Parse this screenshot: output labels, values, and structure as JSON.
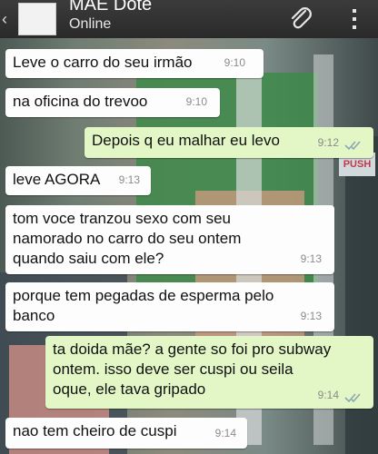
{
  "header": {
    "back_glyph": "‹",
    "contact_name": "MÃE Dote",
    "status": "Online",
    "icons": [
      "back-icon",
      "avatar",
      "paperclip-icon",
      "overflow-menu-icon"
    ]
  },
  "messages": [
    {
      "direction": "in",
      "text": "Leve o carro do seu irmão",
      "time": "9:10"
    },
    {
      "direction": "in",
      "text": "na oficina do trevoo",
      "time": "9:10"
    },
    {
      "direction": "out",
      "text": "Depois q eu malhar eu levo",
      "time": "9:12",
      "read": true
    },
    {
      "direction": "in",
      "text": "leve AGORA",
      "time": "9:13"
    },
    {
      "direction": "in",
      "text": "tom voce tranzou sexo com seu\nnamorado no carro do seu ontem\nquando saiu com ele?",
      "time": "9:13"
    },
    {
      "direction": "in",
      "text": "porque tem pegadas de esperma pelo\nbanco",
      "time": "9:13"
    },
    {
      "direction": "out",
      "text": "ta doida mãe? a gente so foi pro subway\nontem. isso deve ser cuspi ou seila\noque, ele tava gripado",
      "time": "9:14",
      "read": true
    },
    {
      "direction": "in",
      "text": "nao tem cheiro de cuspi",
      "time": "9:14"
    }
  ],
  "wallpaper": {
    "sign_text": "PUSH"
  },
  "colors": {
    "header_bg": "#2f2f2f",
    "incoming_bubble": "#fdfdfd",
    "outgoing_bubble": "#e3f7c6",
    "timestamp": "#8b8b8b",
    "read_ticks": "#8ca5b3"
  }
}
